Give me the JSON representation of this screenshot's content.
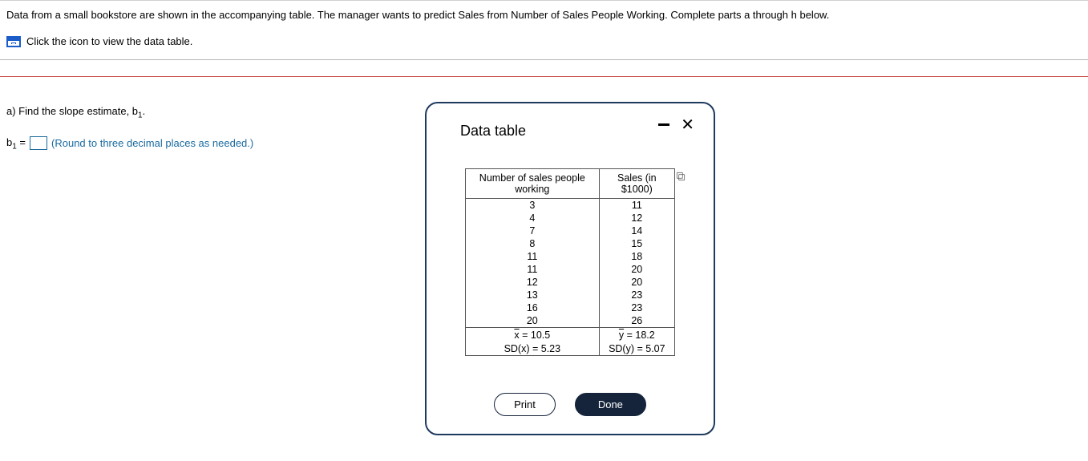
{
  "intro": "Data from a small bookstore are shown in the accompanying table. The manager wants to predict Sales from Number of Sales People Working. Complete parts a through h below.",
  "click_text": "Click the icon to view the data table.",
  "question_a": "a) Find the slope estimate, b",
  "question_a_sub": "1",
  "question_a_end": ".",
  "b_label": "b",
  "b_sub": "1",
  "equals": " = ",
  "hint": "(Round to three decimal places as needed.)",
  "modal": {
    "title": "Data table",
    "print": "Print",
    "done": "Done",
    "col1": "Number of sales people working",
    "col2": "Sales (in $1000)",
    "rows": [
      {
        "x": "3",
        "y": "11"
      },
      {
        "x": "4",
        "y": "12"
      },
      {
        "x": "7",
        "y": "14"
      },
      {
        "x": "8",
        "y": "15"
      },
      {
        "x": "11",
        "y": "18"
      },
      {
        "x": "11",
        "y": "20"
      },
      {
        "x": "12",
        "y": "20"
      },
      {
        "x": "13",
        "y": "23"
      },
      {
        "x": "16",
        "y": "23"
      },
      {
        "x": "20",
        "y": "26"
      }
    ],
    "xbar_label": "x",
    "xbar_eq": " = 10.5",
    "sdx": "SD(x) = 5.23",
    "ybar_label": "y",
    "ybar_eq": " = 18.2",
    "sdy": "SD(y) = 5.07"
  },
  "chart_data": {
    "type": "table",
    "title": "Data table",
    "columns": [
      "Number of sales people working",
      "Sales (in $1000)"
    ],
    "rows": [
      [
        3,
        11
      ],
      [
        4,
        12
      ],
      [
        7,
        14
      ],
      [
        8,
        15
      ],
      [
        11,
        18
      ],
      [
        11,
        20
      ],
      [
        12,
        20
      ],
      [
        13,
        23
      ],
      [
        16,
        23
      ],
      [
        20,
        26
      ]
    ],
    "stats": {
      "x_mean": 10.5,
      "x_sd": 5.23,
      "y_mean": 18.2,
      "y_sd": 5.07
    }
  }
}
